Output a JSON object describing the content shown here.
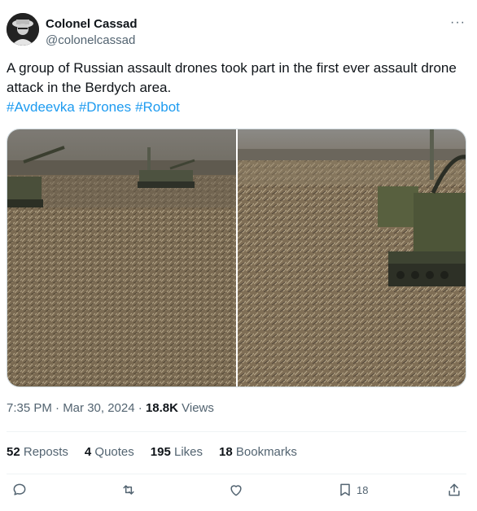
{
  "author": {
    "name": "Colonel Cassad",
    "handle": "@colonelcassad"
  },
  "post": {
    "text": "A group of Russian assault drones took part in the first ever assault drone attack in the Berdych area.",
    "hashtags": [
      "#Avdeevka",
      "#Drones",
      "#Robot"
    ]
  },
  "meta": {
    "timestamp": "7:35 PM · Mar 30, 2024",
    "separator": "·",
    "views_count": "18.8K",
    "views_label": "Views"
  },
  "stats": {
    "reposts_count": "52",
    "reposts_label": "Reposts",
    "quotes_count": "4",
    "quotes_label": "Quotes",
    "likes_count": "195",
    "likes_label": "Likes",
    "bookmarks_count": "18",
    "bookmarks_label": "Bookmarks"
  },
  "actions": {
    "bookmark_count": "18"
  },
  "icons": [
    "more-icon",
    "reply-icon",
    "repost-icon",
    "like-icon",
    "bookmark-icon",
    "share-icon"
  ],
  "colors": {
    "text": "#0f1419",
    "secondary": "#536471",
    "link": "#1d9bf0",
    "divider": "#eff3f4"
  }
}
